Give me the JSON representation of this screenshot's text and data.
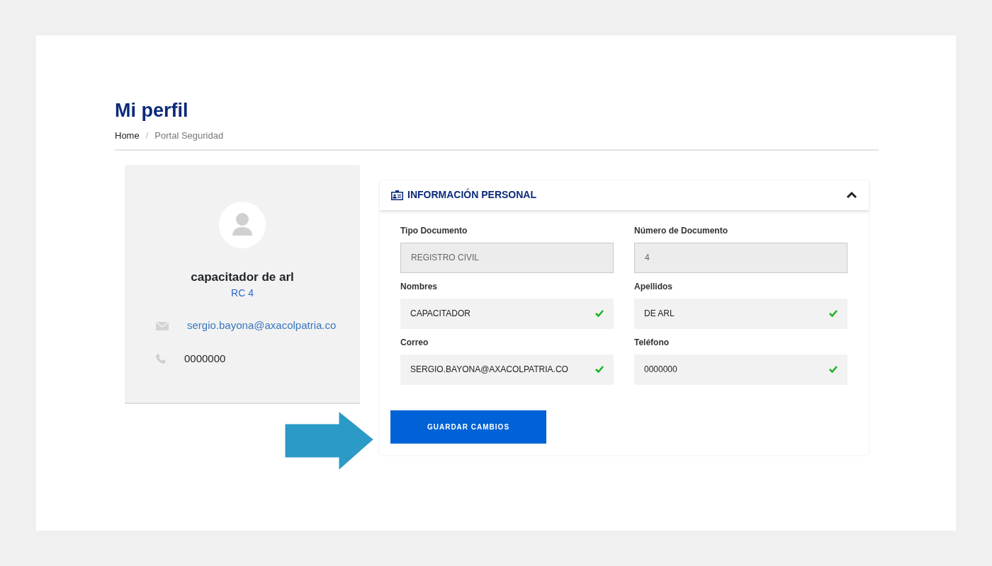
{
  "page": {
    "title": "Mi perfil"
  },
  "breadcrumb_separator": "/",
  "breadcrumb": [
    {
      "label": "Home",
      "current": false
    },
    {
      "label": "Portal Seguridad",
      "current": true
    }
  ],
  "profile": {
    "name": "capacitador de arl",
    "document": "RC 4",
    "email": "sergio.bayona@axacolpatria.co",
    "phone": "0000000"
  },
  "panel": {
    "title": "INFORMACIÓN PERSONAL",
    "expanded": true,
    "fields": [
      {
        "label": "Tipo Documento",
        "value": "REGISTRO CIVIL",
        "disabled": true,
        "valid": false
      },
      {
        "label": "Número de Documento",
        "value": "4",
        "disabled": true,
        "valid": false
      },
      {
        "label": "Nombres",
        "value": "CAPACITADOR",
        "disabled": false,
        "valid": true
      },
      {
        "label": "Apellidos",
        "value": "DE ARL",
        "disabled": false,
        "valid": true
      },
      {
        "label": "Correo",
        "value": "SERGIO.BAYONA@AXACOLPATRIA.CO",
        "disabled": false,
        "valid": true
      },
      {
        "label": "Teléfono",
        "value": "0000000",
        "disabled": false,
        "valid": true
      }
    ]
  },
  "save_button": {
    "label": "GUARDAR CAMBIOS"
  }
}
